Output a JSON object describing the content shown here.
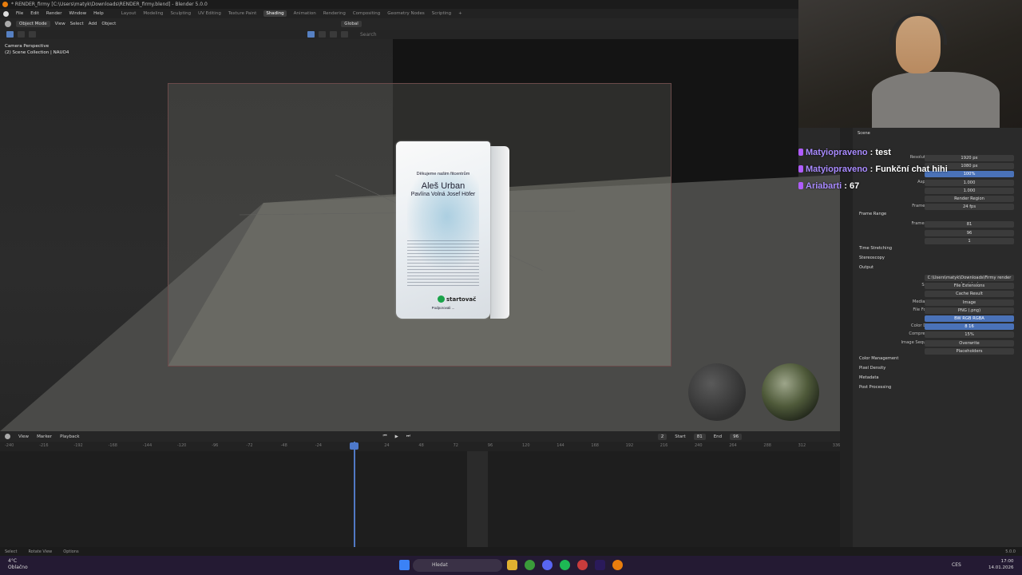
{
  "window": {
    "title": "* RENDER_firmy [C:\\Users\\matyk\\Downloads\\RENDER_firmy.blend] - Blender 5.0.0"
  },
  "menu": {
    "items": [
      "File",
      "Edit",
      "Render",
      "Window",
      "Help"
    ],
    "workspaces": [
      "Layout",
      "Modeling",
      "Sculpting",
      "UV Editing",
      "Texture Paint",
      "Shading",
      "Animation",
      "Rendering",
      "Compositing",
      "Geometry Nodes",
      "Scripting"
    ],
    "active_workspace": "Shading",
    "add_tab": "+"
  },
  "header3d": {
    "mode": "Object Mode",
    "menus": [
      "View",
      "Select",
      "Add",
      "Object"
    ],
    "orientation": "Global",
    "search_placeholder": "Search"
  },
  "viewport": {
    "hud_line1": "Camera Perspective",
    "hud_line2": "(2) Scene Collection | NAUO4"
  },
  "kiosk": {
    "headline": "Děkujeme našim fitcentrům",
    "name1": "Aleš Urban",
    "name2": "Pavlína Volná  Josef Höfer",
    "logo": "startovač",
    "footer": "Podporovali ..."
  },
  "timeline": {
    "menus": [
      "View",
      "Marker",
      "Playback"
    ],
    "current_frame": "2",
    "start_label": "Start",
    "start_value": "81",
    "end_label": "End",
    "end_value": "96",
    "ticks": [
      "-240",
      "-216",
      "-192",
      "-168",
      "-144",
      "-120",
      "-96",
      "-72",
      "-48",
      "-24",
      "0",
      "24",
      "48",
      "72",
      "96",
      "120",
      "144",
      "168",
      "192",
      "216",
      "240",
      "264",
      "288",
      "312",
      "336"
    ]
  },
  "statusbar": {
    "items": [
      "Select",
      "Rotate View",
      "Options"
    ],
    "version": "5.0.0"
  },
  "properties": {
    "title": "Scene",
    "rows": [
      {
        "label": "Resolution X",
        "value": "1920 px"
      },
      {
        "label": "Y",
        "value": "1080 px"
      },
      {
        "label": "%",
        "value": "100%",
        "blue": true
      },
      {
        "label": "Aspect X",
        "value": "1.000"
      },
      {
        "label": "Y",
        "value": "1.000"
      },
      {
        "label": "",
        "value": "Render Region"
      },
      {
        "label": "Frame Rate",
        "value": "24 fps"
      },
      {
        "section": "Frame Range"
      },
      {
        "label": "Frame Start",
        "value": "81"
      },
      {
        "label": "End",
        "value": "96"
      },
      {
        "label": "Step",
        "value": "1"
      },
      {
        "section": "Time Stretching"
      },
      {
        "section": "Stereoscopy"
      },
      {
        "section": "Output"
      },
      {
        "label": "",
        "value": "C:\\Users\\matyk\\Downloads\\Firmy render do videa\\"
      },
      {
        "label": "Saving",
        "value": "File Extensions"
      },
      {
        "label": "",
        "value": "Cache Result"
      },
      {
        "label": "Media Type",
        "value": "Image"
      },
      {
        "label": "File Format",
        "value": "PNG (.png)"
      },
      {
        "label": "Color",
        "value": "BW  RGB  RGBA",
        "blue": true
      },
      {
        "label": "Color Depth",
        "value": "8  16",
        "blue": true
      },
      {
        "label": "Compression",
        "value": "15%"
      },
      {
        "label": "Image Sequence",
        "value": "Overwrite"
      },
      {
        "label": "",
        "value": "Placeholders"
      },
      {
        "section": "Color Management"
      },
      {
        "section": "Pixel Density"
      },
      {
        "section": "Metadata"
      },
      {
        "section": "Post Processing"
      }
    ]
  },
  "chat": [
    {
      "user": "Matyiopraveno",
      "msg": ": test"
    },
    {
      "user": "Matyiopraveno",
      "msg": ": Funkční chat hihi"
    },
    {
      "user": "Ariabarti",
      "msg": ": 67"
    }
  ],
  "taskbar": {
    "weather_temp": "4°C",
    "weather_text": "Oblačno",
    "search": "Hledat",
    "lang": "CES",
    "time": "17:00",
    "date": "14.01.2026"
  }
}
